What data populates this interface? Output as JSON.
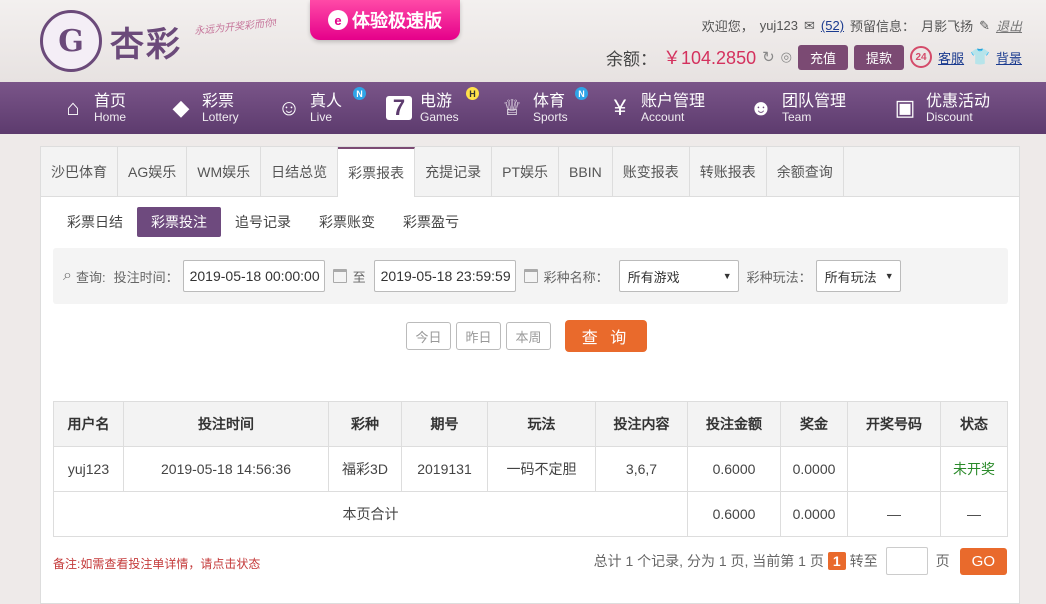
{
  "header": {
    "logo_char": "G",
    "logo_text": "杏彩",
    "slogan": "永远为开奖彩而你!",
    "promo_icon": "e",
    "promo": "体验极速版",
    "welcome": "欢迎您，",
    "username": "yuj123",
    "mail_icon": "mail-icon",
    "mail_count": "(52)",
    "notice_label": "预留信息：",
    "notice_value": "月影飞扬",
    "logout": "退出",
    "balance_label": "余额：",
    "balance": "￥104.2850",
    "deposit": "充值",
    "withdraw": "提款",
    "service_badge": "24",
    "service": "客服",
    "background": "背景"
  },
  "nav": [
    {
      "zh": "首页",
      "en": "Home",
      "icon": "⌂",
      "badge": ""
    },
    {
      "zh": "彩票",
      "en": "Lottery",
      "icon": "◆",
      "badge": ""
    },
    {
      "zh": "真人",
      "en": "Live",
      "icon": "☺",
      "badge": "N"
    },
    {
      "zh": "电游",
      "en": "Games",
      "icon": "7",
      "badge": "H"
    },
    {
      "zh": "体育",
      "en": "Sports",
      "icon": "♕",
      "badge": "N"
    },
    {
      "zh": "账户管理",
      "en": "Account",
      "icon": "¥",
      "badge": ""
    },
    {
      "zh": "团队管理",
      "en": "Team",
      "icon": "☻",
      "badge": ""
    },
    {
      "zh": "优惠活动",
      "en": "Discount",
      "icon": "▣",
      "badge": ""
    }
  ],
  "tabs": [
    "沙巴体育",
    "AG娱乐",
    "WM娱乐",
    "日结总览",
    "彩票报表",
    "充提记录",
    "PT娱乐",
    "BBIN",
    "账变报表",
    "转账报表",
    "余额查询"
  ],
  "active_tab": "彩票报表",
  "subtabs": [
    "彩票日结",
    "彩票投注",
    "追号记录",
    "彩票账变",
    "彩票盈亏"
  ],
  "active_subtab": "彩票投注",
  "search": {
    "query_label": "查询:",
    "time_label": "投注时间：",
    "start": "2019-05-18 00:00:00",
    "to": "至",
    "end": "2019-05-18 23:59:59",
    "lottery_label": "彩种名称：",
    "lottery_value": "所有游戏",
    "play_label": "彩种玩法：",
    "play_value": "所有玩法",
    "today": "今日",
    "yesterday": "昨日",
    "week": "本周",
    "query_button": "查 询"
  },
  "table": {
    "headers": [
      "用户名",
      "投注时间",
      "彩种",
      "期号",
      "玩法",
      "投注内容",
      "投注金额",
      "奖金",
      "开奖号码",
      "状态"
    ],
    "rows": [
      [
        "yuj123",
        "2019-05-18 14:56:36",
        "福彩3D",
        "2019131",
        "一码不定胆",
        "3,6,7",
        "0.6000",
        "0.0000",
        "",
        "未开奖"
      ]
    ],
    "total": {
      "label": "本页合计",
      "amount": "0.6000",
      "bonus": "0.0000",
      "numbers": "—",
      "status": "—"
    }
  },
  "footer": {
    "note": "备注:如需查看投注单详情，请点击状态",
    "summary": "总计 1 个记录, 分为 1 页, 当前第 1 页",
    "current_page": "1",
    "goto": "转至",
    "page_unit": "页",
    "go": "GO"
  }
}
